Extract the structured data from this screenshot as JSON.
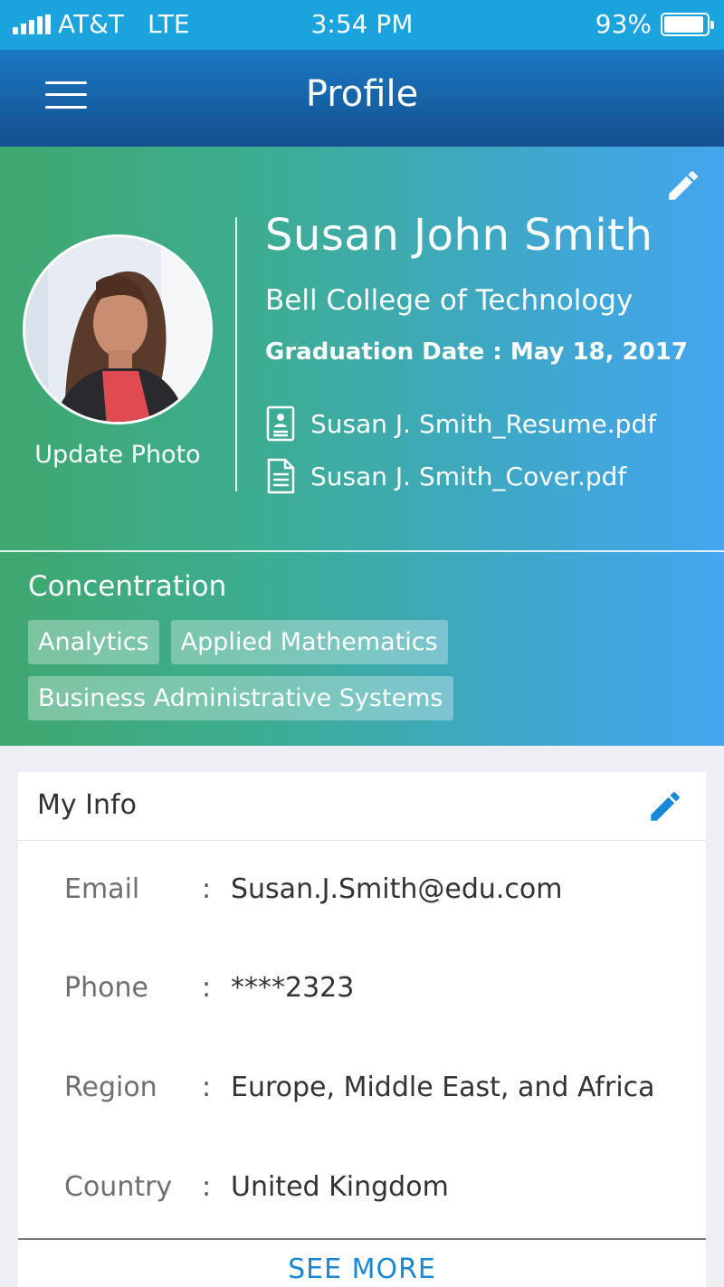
{
  "status_bar": {
    "carrier": "AT&T",
    "network": "LTE",
    "time": "3:54 PM",
    "battery": "93%",
    "battery_level": 0.93
  },
  "nav": {
    "title": "Profile",
    "menu_icon": "hamburger-menu-icon"
  },
  "profile": {
    "name": "Susan John Smith",
    "college": "Bell College of Technology",
    "graduation": "Graduation Date : May 18, 2017",
    "update_photo": "Update Photo",
    "files": [
      {
        "name": "Susan J. Smith_Resume.pdf",
        "icon": "resume-document-icon"
      },
      {
        "name": "Susan J. Smith_Cover.pdf",
        "icon": "document-icon"
      }
    ],
    "concentration_title": "Concentration",
    "concentrations": [
      "Analytics",
      "Applied Mathematics",
      "Business Administrative Systems"
    ]
  },
  "my_info": {
    "title": "My Info",
    "rows": [
      {
        "label": "Email",
        "value": "Susan.J.Smith@edu.com"
      },
      {
        "label": "Phone",
        "value": "****2323"
      },
      {
        "label": "Region",
        "value": "Europe, Middle East, and Africa"
      },
      {
        "label": "Country",
        "value": "United Kingdom"
      }
    ],
    "see_more": "SEE MORE"
  },
  "colors": {
    "accent_blue": "#1a88d6",
    "gradient_green": "#3fa86f",
    "gradient_blue": "#44a6ee"
  }
}
